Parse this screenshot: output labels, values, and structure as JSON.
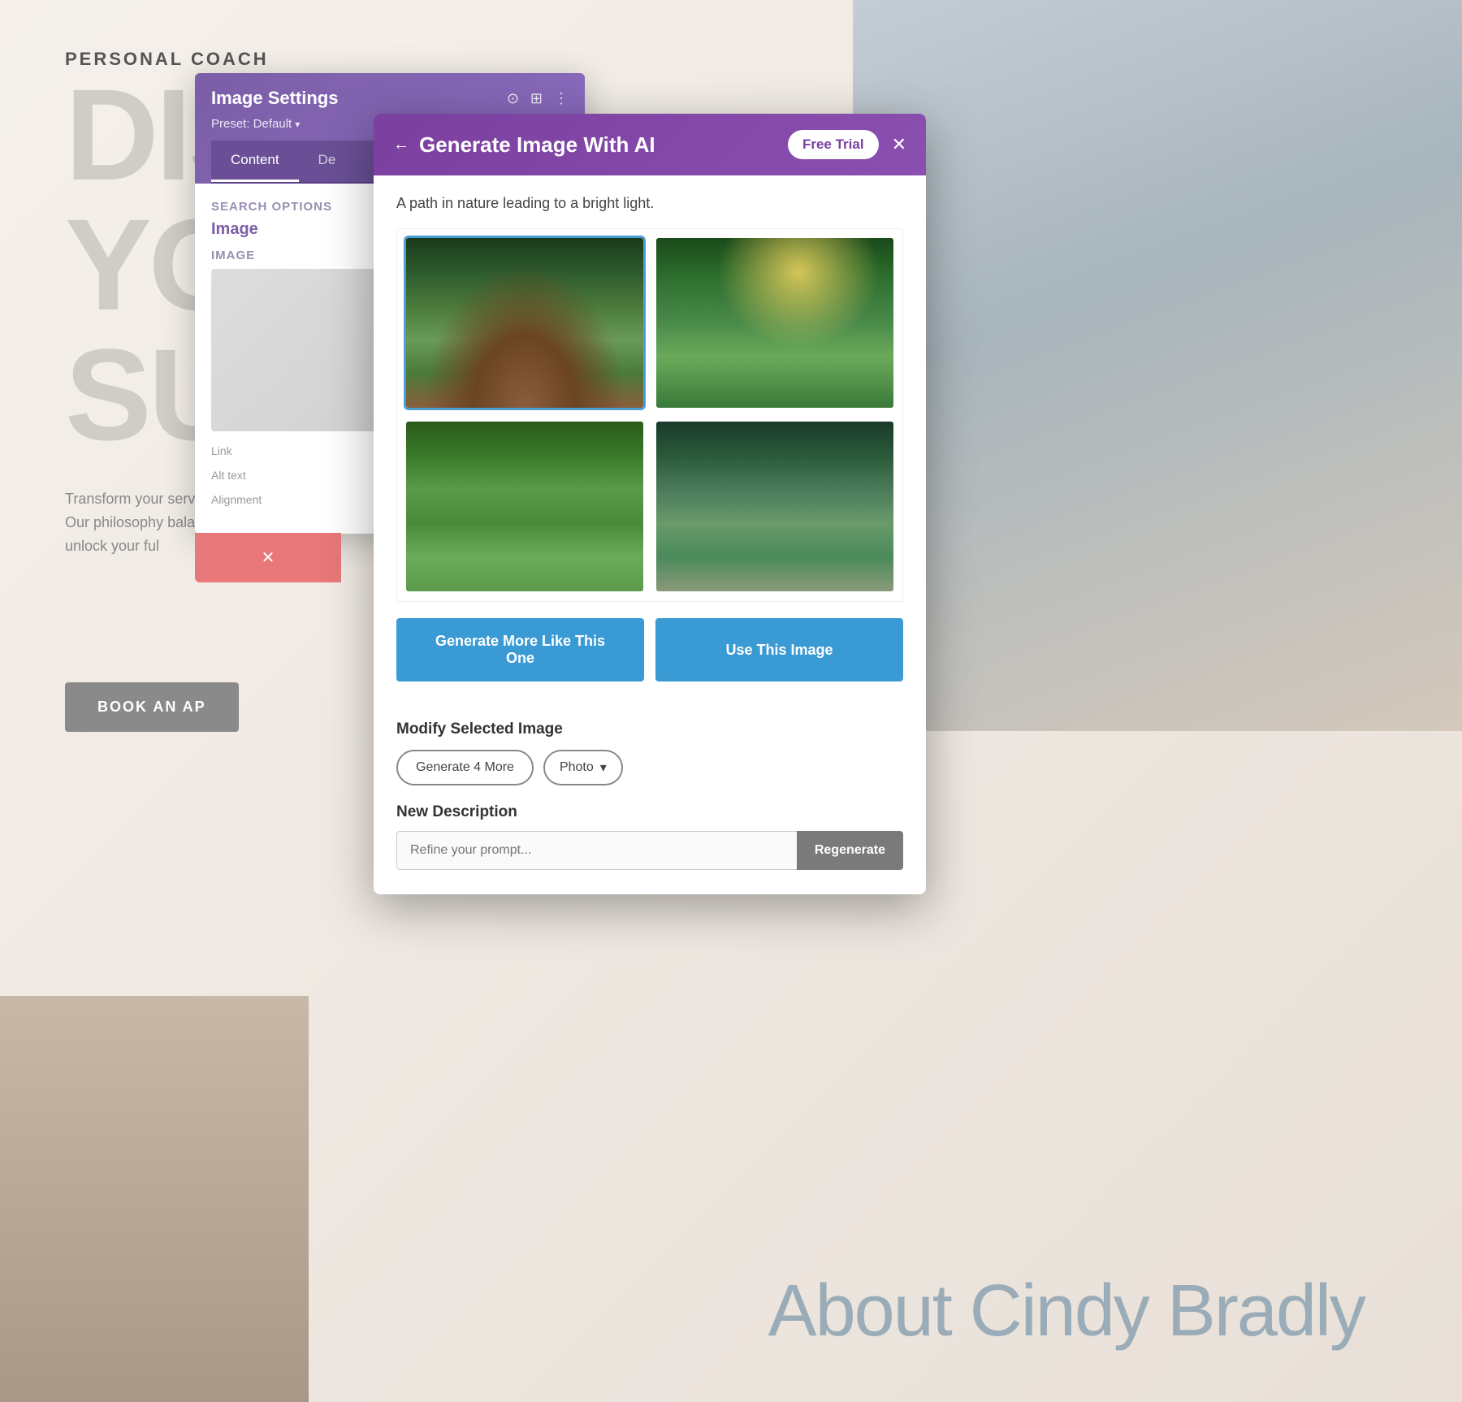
{
  "background": {
    "label": "PERSONAL COACH",
    "line1": "DIS",
    "line2": "YO",
    "line3": "SUC",
    "body_text": "Transform your services. Achieve Our philosophy balance. Empow unlock your ful",
    "book_btn": "BOOK AN AP",
    "about": "About Cindy Bradly"
  },
  "image_settings": {
    "title": "Image Settings",
    "preset": "Preset: Default",
    "tabs": [
      "Content",
      "De"
    ],
    "section_search": "Search Options",
    "section_image": "Image",
    "section_image_label": "Image",
    "delete_icon": "✕"
  },
  "ai_modal": {
    "title": "Generate Image With AI",
    "free_trial_label": "Free Trial",
    "close_label": "✕",
    "back_arrow": "←",
    "prompt_text": "A path in nature leading to a bright light.",
    "images": [
      {
        "id": 1,
        "selected": true,
        "alt": "Forest path dark trees"
      },
      {
        "id": 2,
        "selected": false,
        "alt": "Forest path bright light"
      },
      {
        "id": 3,
        "selected": false,
        "alt": "Green meadow winding path"
      },
      {
        "id": 4,
        "selected": false,
        "alt": "Bamboo forest path"
      }
    ],
    "btn_generate_more": "Generate More Like This One",
    "btn_use_image": "Use This Image",
    "modify_label": "Modify Selected Image",
    "btn_generate_4": "Generate 4 More",
    "photo_option": "Photo",
    "photo_dropdown_arrow": "▾",
    "new_description_label": "New Description",
    "refine_placeholder": "Refine your prompt...",
    "btn_regenerate": "Regenerate"
  }
}
